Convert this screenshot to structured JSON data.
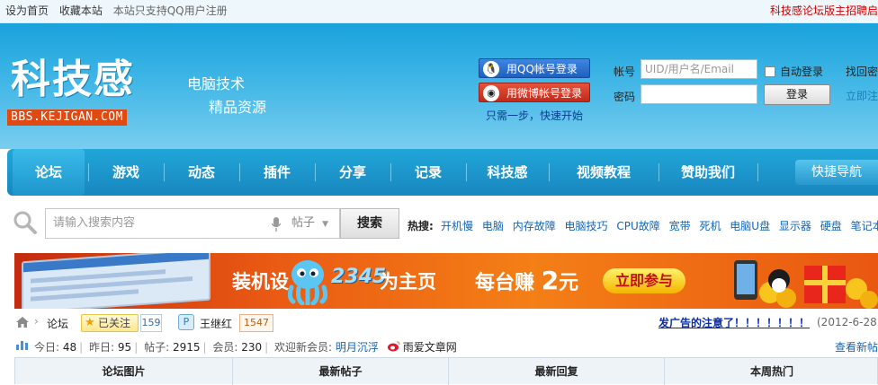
{
  "topbar": {
    "set_home": "设为首页",
    "bookmark": "收藏本站",
    "qq_only": "本站只支持QQ用户注册",
    "recruit": "科技感论坛版主招聘启"
  },
  "header": {
    "logo_text": "科技感",
    "logo_url": "BBS.KEJIGAN.COM",
    "slogan1": "电脑技术",
    "slogan2": "精品资源",
    "qq_login": "用QQ帐号登录",
    "weibo_login": "用微博帐号登录",
    "one_step": "只需一步，快速开始",
    "account_label": "帐号",
    "account_placeholder": "UID/用户名/Email",
    "password_label": "密码",
    "auto_login": "自动登录",
    "login_button": "登录",
    "find_password": "找回密",
    "register_now": "立即注"
  },
  "nav": {
    "items": [
      "论坛",
      "游戏",
      "动态",
      "插件",
      "分享",
      "记录",
      "科技感",
      "视频教程",
      "赞助我们"
    ],
    "active_index": 0,
    "quick_nav": "快捷导航"
  },
  "search": {
    "placeholder": "请输入搜索内容",
    "scope": "帖子",
    "button": "搜索",
    "hot_label": "热搜:",
    "hot_links": [
      "开机慢",
      "电脑",
      "内存故障",
      "电脑技巧",
      "CPU故障",
      "宽带",
      "死机",
      "电脑U盘",
      "显示器",
      "硬盘",
      "笔记本"
    ]
  },
  "banner": {
    "text1": "装机设",
    "brand": "2345",
    "text2": "为主页",
    "text3_prefix": "每台赚",
    "text3_amount": "2",
    "text3_suffix": "元",
    "cta": "立即参与"
  },
  "breadcrumb": {
    "forum": "论坛",
    "followed": "已关注",
    "followed_count": "159",
    "moderator": "王继红",
    "moderator_count": "1547",
    "notice": "发广告的注意了！！！！！！！",
    "notice_date": "(2012-6-28)"
  },
  "stats": {
    "today_label": "今日:",
    "today": "48",
    "yesterday_label": "昨日:",
    "yesterday": "95",
    "posts_label": "帖子:",
    "posts": "2915",
    "members_label": "会员:",
    "members": "230",
    "welcome_label": "欢迎新会员:",
    "new_member": "明月沉浮",
    "weibo_site": "雨爱文章网",
    "view_new": "查看新帖"
  },
  "tabs": [
    "论坛图片",
    "最新帖子",
    "最新回复",
    "本周热门"
  ],
  "colors": {
    "header_blue": "#1aa2dc",
    "nav_blue": "#1887bf",
    "accent_red": "#d10000",
    "link_blue": "#1465b7"
  }
}
